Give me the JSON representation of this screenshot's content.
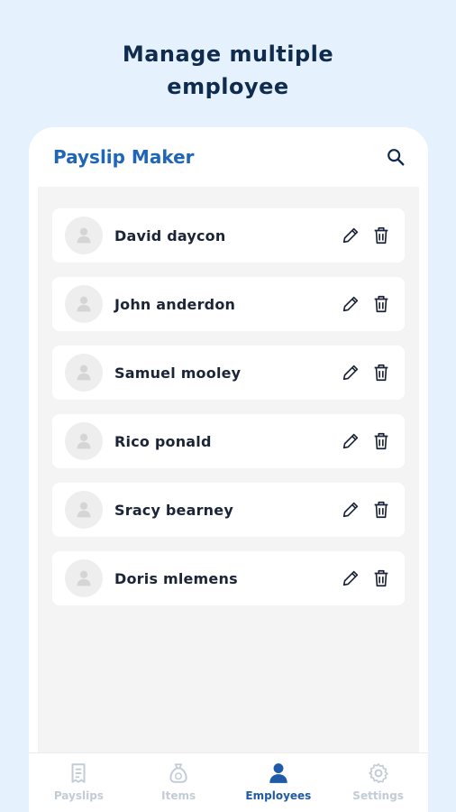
{
  "promo": {
    "line1": "Manage multiple",
    "line2": "employee"
  },
  "appbar": {
    "title": "Payslip Maker",
    "search_icon": "search-icon"
  },
  "employees": [
    {
      "name": "David daycon"
    },
    {
      "name": "John anderdon"
    },
    {
      "name": "Samuel mooley"
    },
    {
      "name": "Rico ponald"
    },
    {
      "name": "Sracy bearney"
    },
    {
      "name": "Doris mlemens"
    }
  ],
  "fab": {
    "icon": "plus-icon"
  },
  "nav": {
    "active": "Employees",
    "items": [
      {
        "label": "Payslips",
        "icon": "receipt-icon"
      },
      {
        "label": "Items",
        "icon": "money-bag-icon"
      },
      {
        "label": "Employees",
        "icon": "person-icon"
      },
      {
        "label": "Settings",
        "icon": "gear-icon"
      }
    ]
  },
  "colors": {
    "background": "#e5f1fc",
    "accent": "#1f6ab8",
    "title": "#1f66b8",
    "inactive": "#c3ccd6"
  }
}
